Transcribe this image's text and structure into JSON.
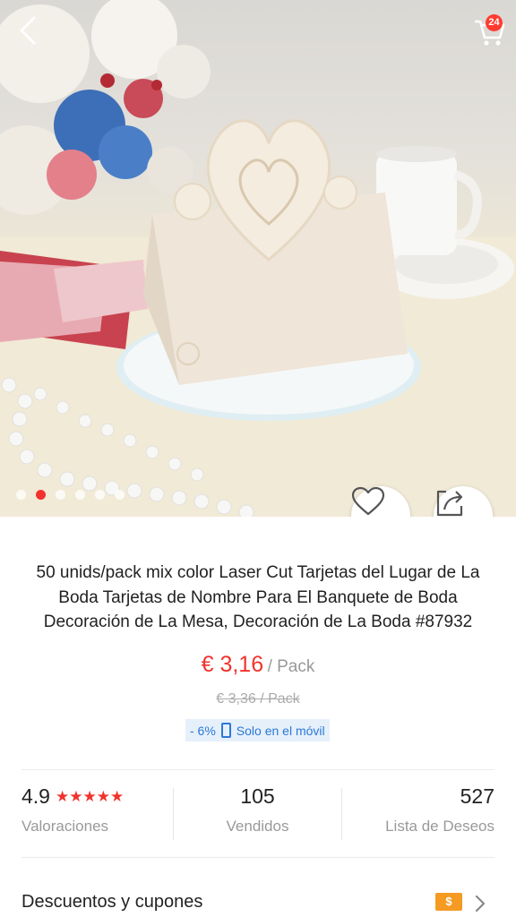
{
  "header": {
    "back_icon": "chevron-left-icon",
    "cart_icon": "cart-icon",
    "cart_count": "24"
  },
  "gallery": {
    "dot_count": 6,
    "active_index": 1,
    "wishlist_icon": "heart-icon",
    "share_icon": "share-icon"
  },
  "product": {
    "title": "50 unids/pack mix color Laser Cut Tarjetas del Lugar de La Boda Tarjetas de Nombre Para El Banquete de Boda Decoración de La Mesa, Decoración de La Boda #87932",
    "price": "€ 3,16",
    "price_unit": "/ Pack",
    "old_price": "€ 3,36  / Pack",
    "discount": "- 6%",
    "mobile_only": "Solo en el móvil"
  },
  "stats": {
    "rating": "4.9",
    "stars": "★★★★★",
    "rating_label": "Valoraciones",
    "sold": "105",
    "sold_label": "Vendidos",
    "wishlist": "527",
    "wishlist_label": "Lista de Deseos"
  },
  "coupons": {
    "label": "Descuentos y cupones",
    "icon_text": "$"
  },
  "colors": {
    "accent": "#f2322c",
    "promo_blue": "#2b78d6",
    "coupon_orange": "#f59a23"
  }
}
